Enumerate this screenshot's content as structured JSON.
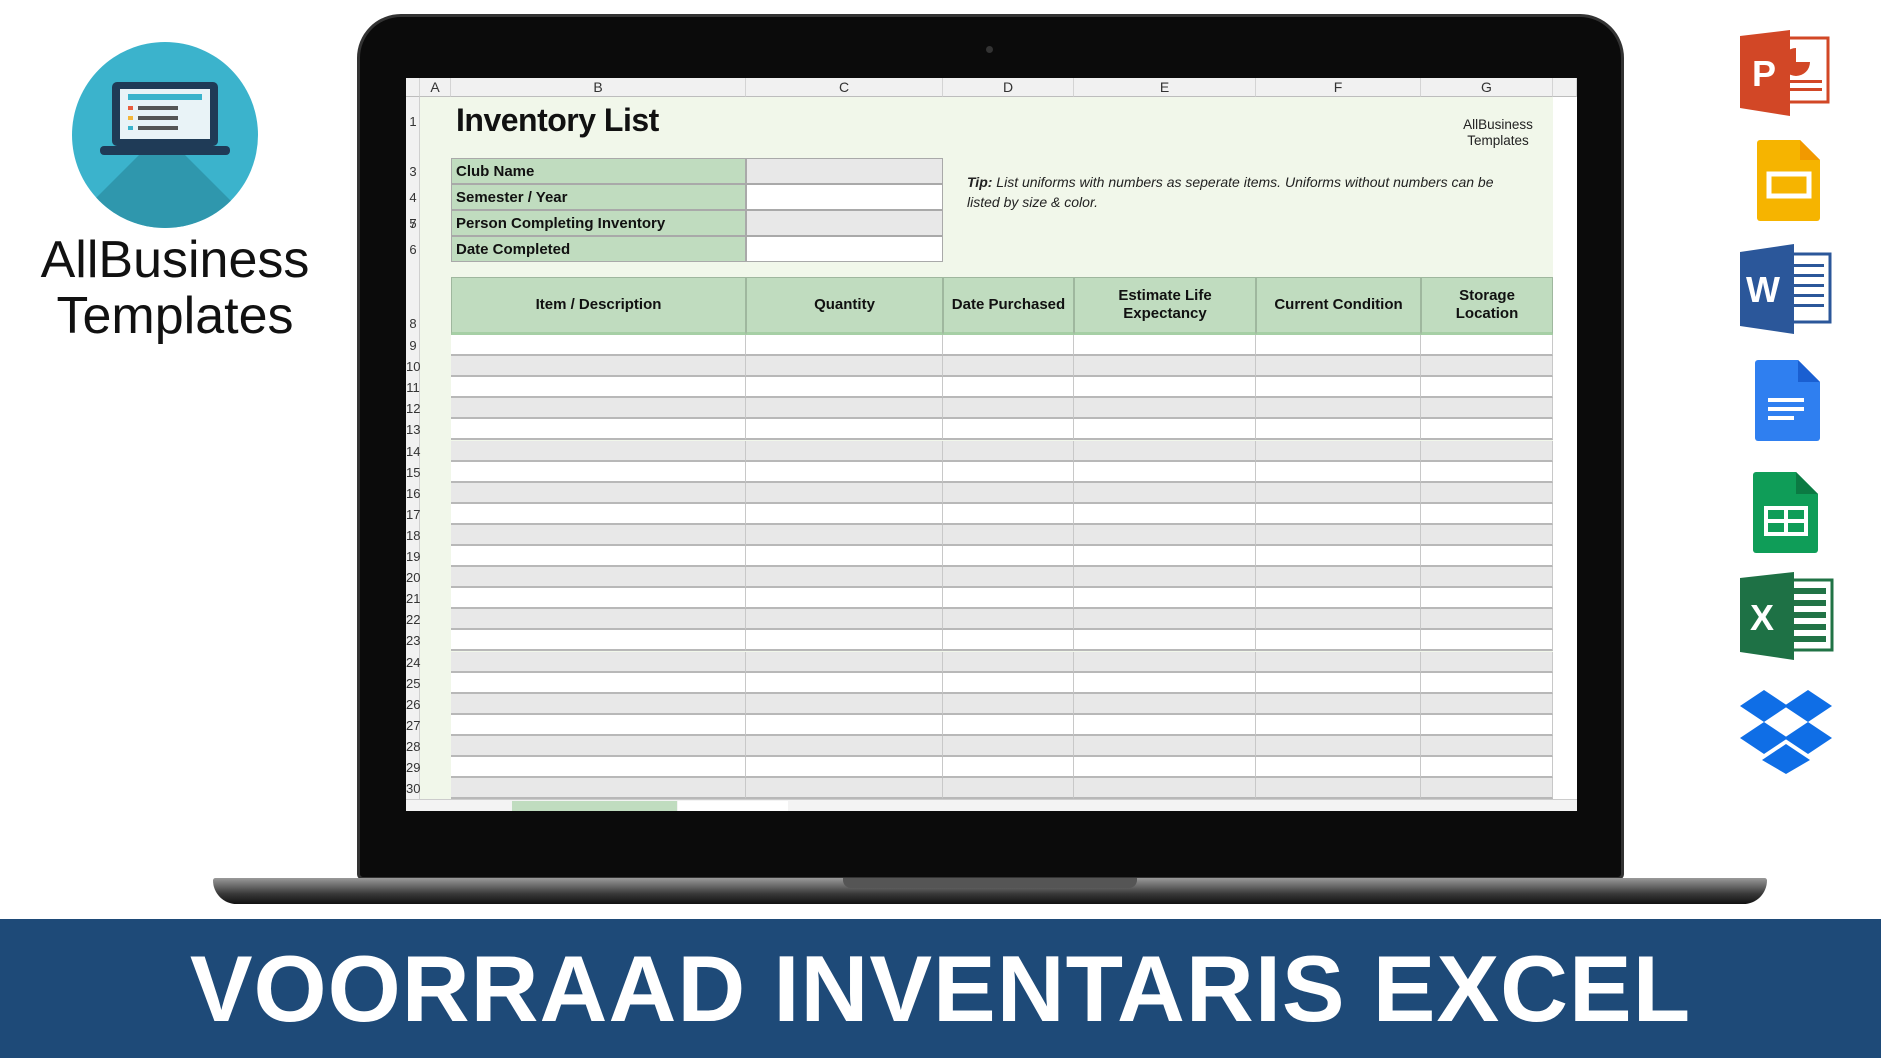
{
  "brand": {
    "name_line1": "AllBusiness",
    "name_line2": "Templates"
  },
  "sheet": {
    "columns": [
      "A",
      "B",
      "C",
      "D",
      "E",
      "F",
      "G"
    ],
    "title": "Inventory List",
    "info_rows": [
      {
        "row": "3",
        "label": "Club Name",
        "value": ""
      },
      {
        "row": "4",
        "label": "Semester / Year",
        "value": ""
      },
      {
        "row": "5",
        "label": "Person Completing Inventory",
        "value": ""
      },
      {
        "row": "6",
        "label": "Date Completed",
        "value": ""
      }
    ],
    "row_labels_top": [
      "1",
      "7",
      "8"
    ],
    "tip_label": "Tip:",
    "tip_text": " List uniforms with numbers as seperate items. Uniforms without numbers can be listed by size & color.",
    "logo_line1": "AllBusiness",
    "logo_line2": "Templates",
    "table_headers": [
      "Item / Description",
      "Quantity",
      "Date Purchased",
      "Estimate Life Expectancy",
      "Current Condition",
      "Storage Location"
    ],
    "data_rows": [
      "9",
      "10",
      "11",
      "12",
      "13",
      "14",
      "15",
      "16",
      "17",
      "18",
      "19",
      "20",
      "21",
      "22",
      "23",
      "24",
      "25",
      "26",
      "27",
      "28",
      "29",
      "30"
    ],
    "colors": {
      "header_green": "#c0dcbf",
      "sheet_bg": "#f1f7ea",
      "row_alt": "#e8e8e8"
    }
  },
  "banner": {
    "text": "VOORRAAD INVENTARIS EXCEL",
    "color": "#1e4a78"
  },
  "app_icons": [
    "powerpoint-icon",
    "google-slides-icon",
    "word-icon",
    "google-docs-icon",
    "google-sheets-icon",
    "excel-icon",
    "dropbox-icon"
  ]
}
